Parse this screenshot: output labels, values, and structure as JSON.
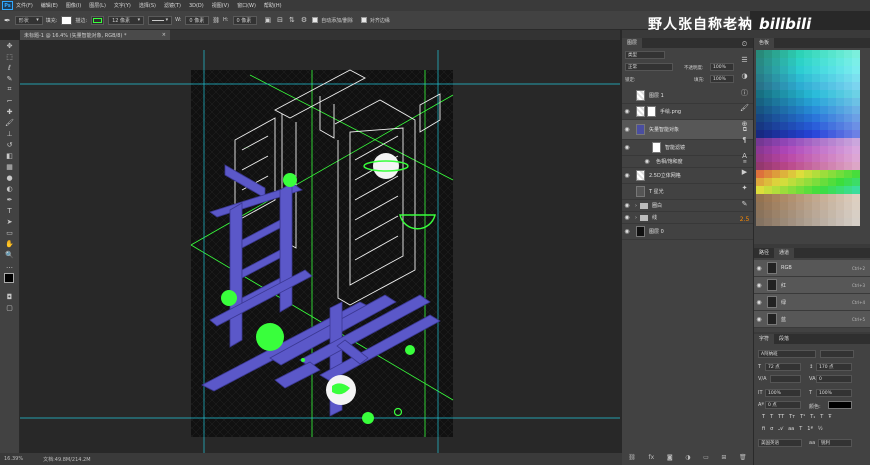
{
  "menubar": {
    "items": [
      "文件(F)",
      "编辑(E)",
      "图像(I)",
      "图层(L)",
      "文字(Y)",
      "选择(S)",
      "滤镜(T)",
      "3D(D)",
      "视图(V)",
      "窗口(W)",
      "帮助(H)"
    ],
    "logo": "Ps"
  },
  "options": {
    "mode": "形状",
    "fill_label": "填充:",
    "stroke_label": "描边:",
    "stroke_size": "12 像素",
    "w_label": "W:",
    "w_value": "0 像素",
    "h_label": "H:",
    "h_value": "0 像素",
    "auto_add_label": "自动添加/删除",
    "align_label": "对齐边缘"
  },
  "watermark": {
    "text": "野人张自称老衲",
    "logo": "bilibili"
  },
  "document": {
    "tab": "未标题-1 @ 16.4% (矢量智能对象, RGB/8) *"
  },
  "status": {
    "zoom": "16.39%",
    "doc": "文档:49.8M/214.2M"
  },
  "layers_panel": {
    "tab": "图层",
    "kind": "类型",
    "blend": "正常",
    "opacity_label": "不透明度:",
    "opacity": "100%",
    "lock_label": "锁定:",
    "fill_label": "填充:",
    "fill": "100%",
    "layers": [
      {
        "name": "图层 1"
      },
      {
        "name": "手绘.png"
      },
      {
        "name": "矢量智能对象"
      },
      {
        "name": "智能滤镜"
      },
      {
        "name": "色相/饱和度"
      },
      {
        "name": "2.5D立体网格"
      },
      {
        "name": "T  星光"
      },
      {
        "name": "圈白"
      },
      {
        "name": "线"
      },
      {
        "name": "图层 0"
      }
    ]
  },
  "swatches_panel": {
    "tab": "色板"
  },
  "channels_panel": {
    "tabs": [
      "路径",
      "通道"
    ],
    "channels": [
      {
        "name": "RGB",
        "key": "Ctrl+2"
      },
      {
        "name": "红",
        "key": "Ctrl+3"
      },
      {
        "name": "绿",
        "key": "Ctrl+4"
      },
      {
        "name": "蓝",
        "key": "Ctrl+5"
      }
    ]
  },
  "character_panel": {
    "tabs": [
      "字符",
      "段落"
    ],
    "font": "A阿纳班",
    "size": "72 点",
    "leading": "170 点",
    "tracking": "0",
    "vscale": "100%",
    "hscale": "100%",
    "baseline": "0 点",
    "color_label": "颜色:",
    "lang": "美国英语",
    "aa": "锐利"
  },
  "colors": {
    "accent_green": "#39ff3c",
    "artwork_purple": "#5b58c9",
    "guide": "#22c6d8"
  },
  "side_label": "2.5"
}
